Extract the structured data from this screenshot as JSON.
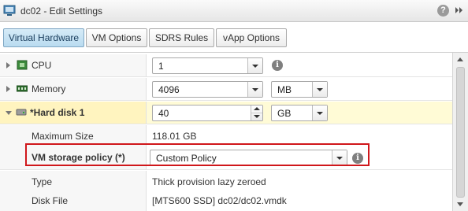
{
  "window": {
    "title": "dc02 - Edit Settings",
    "icons": {
      "vm": "vm-icon",
      "help": "help-icon",
      "expand": "expand-icon"
    },
    "help_glyph": "?"
  },
  "tabs": [
    {
      "label": "Virtual Hardware",
      "active": true
    },
    {
      "label": "VM Options",
      "active": false
    },
    {
      "label": "SDRS Rules",
      "active": false
    },
    {
      "label": "vApp Options",
      "active": false
    }
  ],
  "hardware": {
    "cpu": {
      "label": "CPU",
      "icon": "cpu-icon",
      "value": "1"
    },
    "memory": {
      "label": "Memory",
      "icon": "memory-icon",
      "value": "4096",
      "unit": "MB"
    },
    "hard_disk": {
      "label": "*Hard disk 1",
      "icon": "hard-disk-icon",
      "value": "40",
      "unit": "GB",
      "details": {
        "max_size_label": "Maximum Size",
        "max_size_value": "118.01 GB",
        "storage_policy_label": "VM storage policy (*)",
        "storage_policy_value": "Custom Policy",
        "type_label": "Type",
        "type_value": "Thick provision lazy zeroed",
        "disk_file_label": "Disk File",
        "disk_file_value": "[MTS600 SSD] dc02/dc02.vmdk"
      }
    }
  },
  "info_glyph": "i",
  "colors": {
    "highlight_row": "#fff4bf",
    "callout_border": "#d0171b",
    "active_tab": "#b9dbf0"
  }
}
